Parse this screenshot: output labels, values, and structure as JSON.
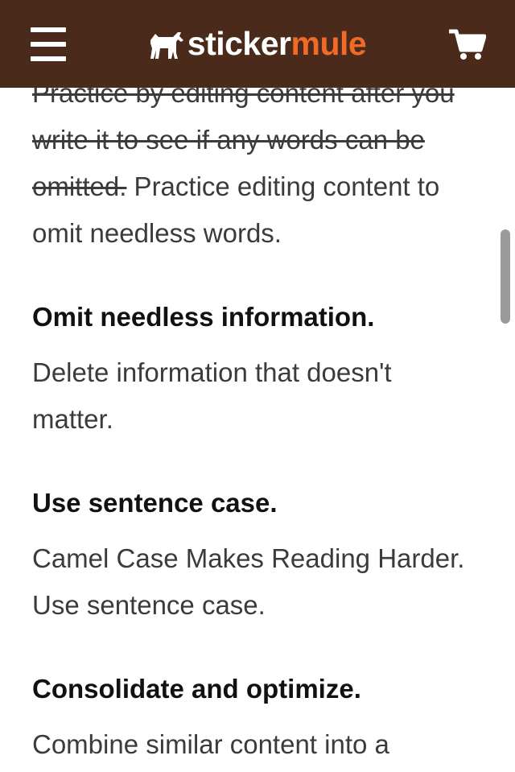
{
  "header": {
    "brand_left": "sticker",
    "brand_right": "mule",
    "menu_icon": "hamburger-menu-icon",
    "cart_icon": "shopping-cart-icon",
    "colors": {
      "background": "#4a2a1b",
      "accent": "#f06a28",
      "text": "#ffffff"
    }
  },
  "article": {
    "intro_strike": "Practice by editing content after you write it to see if any words can be omitted.",
    "intro_rest": " Practice editing content to omit needless words.",
    "sections": [
      {
        "heading": "Omit needless information.",
        "body": "Delete information that doesn't matter."
      },
      {
        "heading": "Use sentence case.",
        "body": "Camel Case Makes Reading Harder. Use sentence case."
      },
      {
        "heading": "Consolidate and optimize.",
        "body": "Combine similar content into a"
      }
    ]
  }
}
